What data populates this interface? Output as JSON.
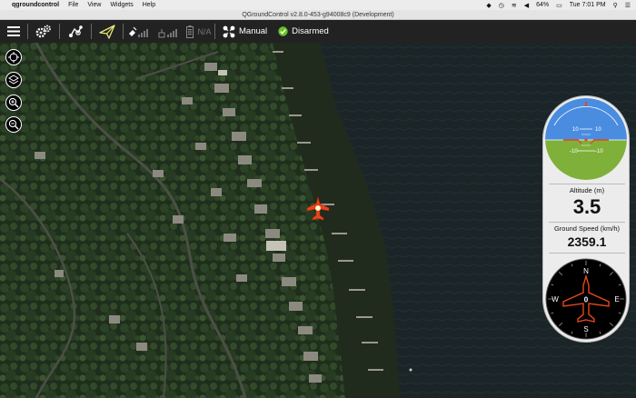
{
  "menubar": {
    "app_name": "qgroundcontrol",
    "menus": [
      "File",
      "View",
      "Widgets",
      "Help"
    ],
    "battery": "64%",
    "clock": "Tue 7:01 PM"
  },
  "window": {
    "title": "QGroundControl v2.8.0-453-g94008c9 (Development)"
  },
  "toolbar": {
    "battery_status": "N/A",
    "flight_mode": "Manual",
    "arm_state": "Disarmed"
  },
  "instruments": {
    "attitude": {
      "pitch_ticks": [
        "10",
        "10",
        "-10",
        "-10"
      ]
    },
    "altitude_label": "Altitude (m)",
    "altitude_value": "3.5",
    "ground_speed_label": "Ground Speed (km/h)",
    "ground_speed_value": "2359.1",
    "compass": {
      "n": "N",
      "s": "S",
      "e": "E",
      "w": "W",
      "heading_value": "0"
    }
  },
  "colors": {
    "toolbar_bg": "#222222",
    "accent": "#e8e87a",
    "vehicle": "#e8451d",
    "sky": "#4a8de0",
    "ground": "#7fb03a"
  }
}
